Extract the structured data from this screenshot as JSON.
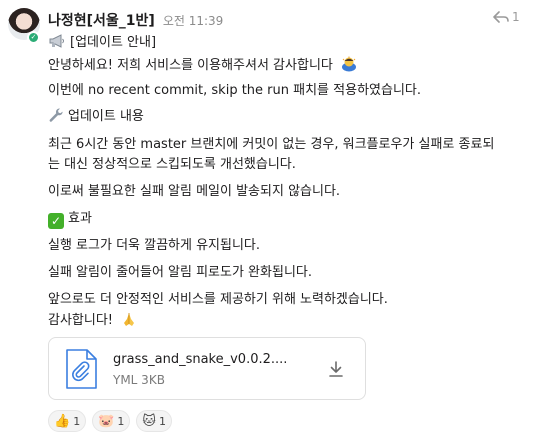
{
  "message": {
    "sender": "나정현[서울_1반]",
    "time": "오전 11:39",
    "reply_count": "1",
    "title": "[업데이트 안내]",
    "greeting": "안녕하세요! 저희 서비스를 이용해주셔서 감사합니다",
    "patch_line": "이번에 no recent commit, skip the run 패치를 적용하였습니다.",
    "update_heading": "업데이트 내용",
    "update_body_1": "최근 6시간 동안 master 브랜치에 커밋이 없는 경우, 워크플로우가 실패로 종료되",
    "update_body_2": "는 대신 정상적으로 스킵되도록 개선했습니다.",
    "no_more_mail": "이로써 불필요한 실패 알림 메일이 발송되지 않습니다.",
    "effect_heading": "효과",
    "effect_1": "실행 로그가 더욱 깔끔하게 유지됩니다.",
    "effect_2": "실패 알림이 줄어들어 알림 피로도가 완화됩니다.",
    "closing_1": "앞으로도 더 안정적인 서비스를 제공하기 위해 노력하겠습니다.",
    "closing_2": "감사합니다!"
  },
  "attachment": {
    "name": "grass_and_snake_v0.0.2....",
    "meta": "YML 3KB"
  },
  "reactions": [
    {
      "emoji": "👍",
      "count": "1",
      "icon": "thumbs-up-icon"
    },
    {
      "emoji": "🐷",
      "count": "1",
      "icon": "pig-face-icon"
    },
    {
      "emoji": "🐱",
      "count": "1",
      "icon": "cat-icon"
    }
  ],
  "colors": {
    "presence": "#2bac76",
    "check": "#43b02a",
    "file_blue": "#3b7fe0"
  }
}
